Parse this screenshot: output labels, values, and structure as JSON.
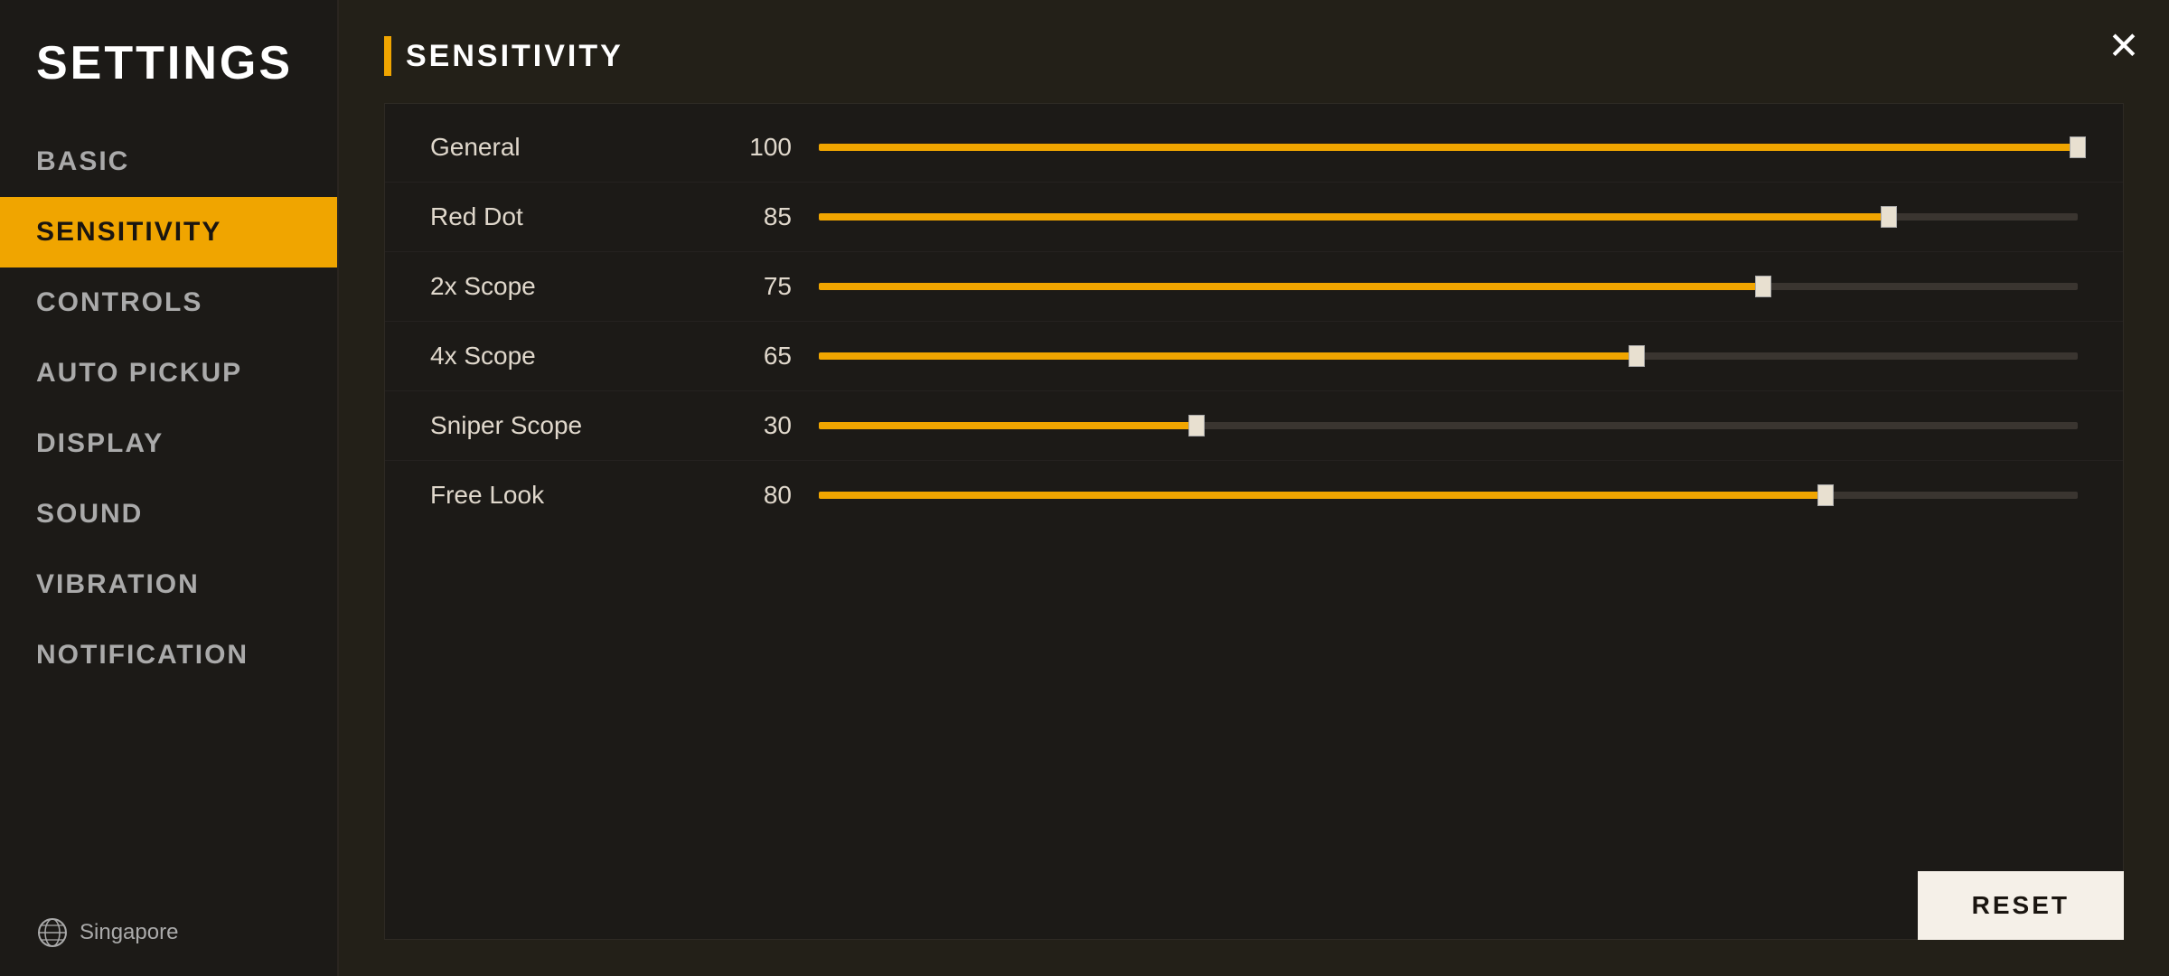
{
  "sidebar": {
    "title": "SETTINGS",
    "items": [
      {
        "label": "BASIC",
        "active": false,
        "id": "basic"
      },
      {
        "label": "SENSITIVITY",
        "active": true,
        "id": "sensitivity"
      },
      {
        "label": "CONTROLS",
        "active": false,
        "id": "controls"
      },
      {
        "label": "AUTO PICKUP",
        "active": false,
        "id": "auto-pickup"
      },
      {
        "label": "DISPLAY",
        "active": false,
        "id": "display"
      },
      {
        "label": "SOUND",
        "active": false,
        "id": "sound"
      },
      {
        "label": "VIBRATION",
        "active": false,
        "id": "vibration"
      },
      {
        "label": "NOTIFICATION",
        "active": false,
        "id": "notification"
      }
    ],
    "footer": {
      "region": "Singapore",
      "icon": "globe"
    }
  },
  "main": {
    "section_title": "SENSITIVITY",
    "sliders": [
      {
        "label": "General",
        "value": 100,
        "percent": 100
      },
      {
        "label": "Red Dot",
        "value": 85,
        "percent": 85
      },
      {
        "label": "2x Scope",
        "value": 75,
        "percent": 75
      },
      {
        "label": "4x Scope",
        "value": 65,
        "percent": 65
      },
      {
        "label": "Sniper Scope",
        "value": 30,
        "percent": 30
      },
      {
        "label": "Free Look",
        "value": 80,
        "percent": 80
      }
    ],
    "reset_button": "RESET",
    "close_button": "✕"
  },
  "colors": {
    "accent": "#f0a500",
    "bg_dark": "#1a1510",
    "bg_sidebar": "#1c1a17",
    "bg_main": "#232018",
    "text_light": "#e0d8cc",
    "text_muted": "#aaaaaa",
    "track_bg": "#3a3530"
  }
}
